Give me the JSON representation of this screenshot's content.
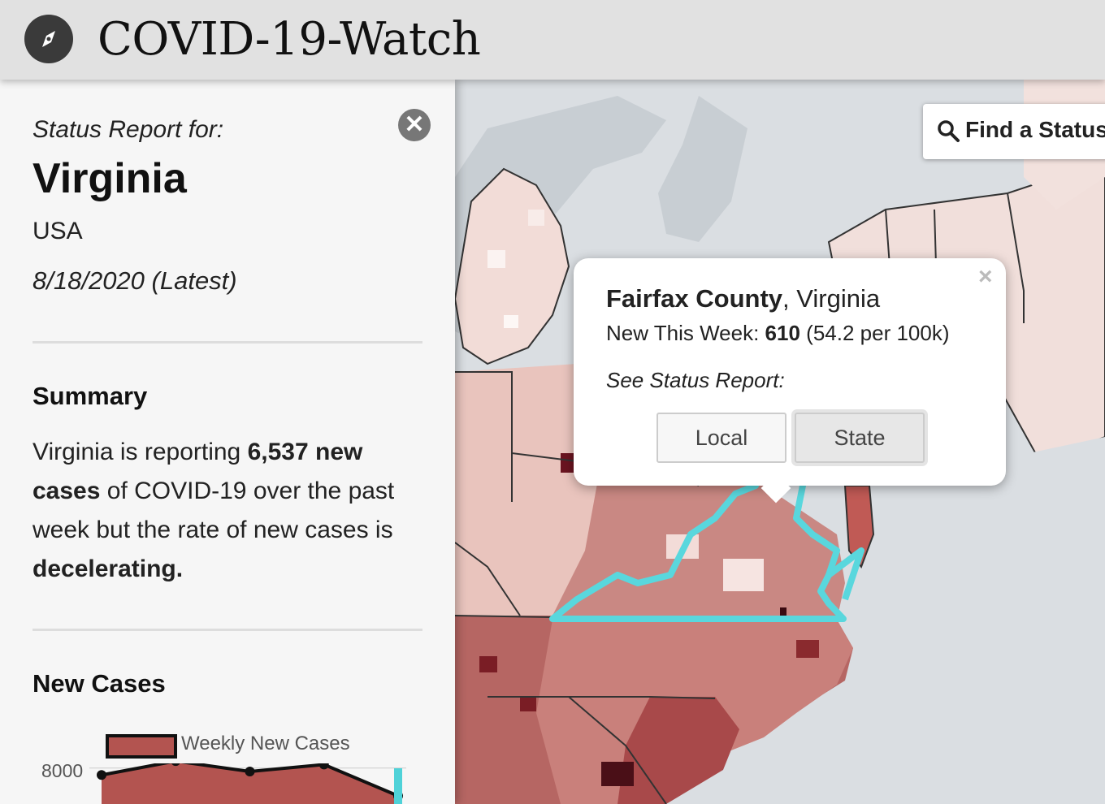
{
  "app": {
    "title": "COVID-19-Watch",
    "icon": "compass-icon"
  },
  "panel": {
    "status_for": "Status Report for:",
    "region": "Virginia",
    "country": "USA",
    "date": "8/18/2020 (Latest)",
    "summary_heading": "Summary",
    "summary": {
      "p1": "Virginia is reporting ",
      "b1": "6,537 new cases",
      "p2": " of COVID-19 over the past week but the rate of new cases is ",
      "b2": "decelerating."
    },
    "new_cases_heading": "New Cases"
  },
  "chart_data": {
    "type": "area",
    "series": [
      {
        "name": "Weekly New Cases",
        "values": [
          7800,
          8200,
          7900,
          8100,
          7200
        ]
      }
    ],
    "yticks": [
      "8000"
    ],
    "ylim": [
      6500,
      8600
    ],
    "color": "#b35450",
    "highlight_color": "#4fd2d8"
  },
  "map": {
    "find_button": "Find a Status",
    "popup": {
      "county": "Fairfax County",
      "state": ", Virginia",
      "new_label": "New This Week: ",
      "new_value": "610",
      "rate": " (54.2 per 100k)",
      "see_label": "See Status Report:",
      "buttons": [
        "Local",
        "State"
      ]
    },
    "outline_color": "#59d7dd"
  }
}
